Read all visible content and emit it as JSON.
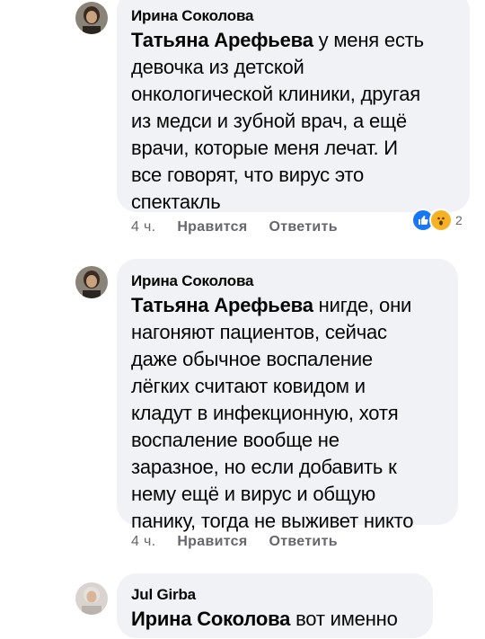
{
  "comments": [
    {
      "author": "Ирина Соколова",
      "mention": "Татьяна Арефьева",
      "lines": [
        " у меня есть",
        "девочка из детской",
        "онкологической клиники, другая",
        "из медси и зубной врач, а ещё",
        "врачи, которые меня лечат. И",
        "все говорят, что вирус это",
        "спектакль"
      ],
      "time": "4 ч.",
      "like_label": "Нравится",
      "reply_label": "Ответить",
      "reaction_count": "2",
      "reaction_icons": [
        "like-icon",
        "wow-icon"
      ]
    },
    {
      "author": "Ирина Соколова",
      "mention": "Татьяна Арефьева",
      "lines": [
        " нигде, они",
        "нагоняют пациентов, сейчас",
        "даже обычное воспаление",
        "лёгких считают ковидом и",
        "кладут в инфекционную, хотя",
        "воспаление вообще не",
        "заразное, но если добавить к",
        "нему ещё и вирус и общую",
        "панику, тогда не выживет никто"
      ],
      "time": "4 ч.",
      "like_label": "Нравится",
      "reply_label": "Ответить"
    },
    {
      "author": "Jul Girba",
      "mention": "Ирина Соколова",
      "lines": [
        " вот именно"
      ]
    }
  ],
  "colors": {
    "bubble": "#f0f2f5",
    "meta": "#65676b",
    "like_blue": "#1877f2",
    "wow_yellow": "#f7b125"
  }
}
